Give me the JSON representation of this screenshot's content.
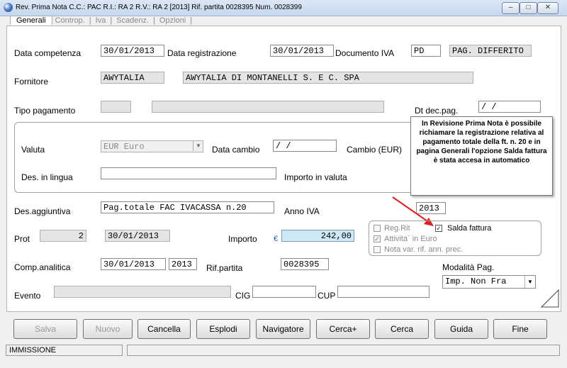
{
  "window": {
    "title": "Rev. Prima Nota C.C.: PAC  R.I.: RA     2 R.V.: RA     2 [2013]    Rif. partita 0028395 Num. 0028399",
    "minimize": "–",
    "maximize": "□",
    "close": "✕"
  },
  "tabs": [
    "Generali",
    "Controp.",
    "Iva",
    "Scadenz.",
    "Opzioni"
  ],
  "tab_separator": "|",
  "form": {
    "data_competenza": {
      "label": "Data competenza",
      "value": "30/01/2013"
    },
    "data_registrazione": {
      "label": "Data registrazione",
      "value": "30/01/2013"
    },
    "documento_iva": {
      "label": "Documento IVA",
      "value": "PD",
      "description": "PAG. DIFFERITO"
    },
    "fornitore": {
      "label": "Fornitore",
      "code": "AWYTALIA",
      "name": "AWYTALIA DI MONTANELLI S. E C. SPA"
    },
    "tipo_pagamento": {
      "label": "Tipo pagamento",
      "code": "",
      "description": ""
    },
    "dt_dec_pag": {
      "label": "Dt dec.pag.",
      "value": " /  /"
    },
    "valuta": {
      "label": "Valuta",
      "value": "EUR Euro",
      "arrow": "▼"
    },
    "data_cambio": {
      "label": "Data cambio",
      "value": " /  /"
    },
    "cambio": {
      "label": "Cambio  (EUR)"
    },
    "des_lingua": {
      "label": "Des. in lingua",
      "value": ""
    },
    "importo_valuta": {
      "label": "Importo in valuta"
    },
    "des_aggiuntiva": {
      "label": "Des.aggiuntiva",
      "value": "Pag.totale FAC IVACASSA n.20"
    },
    "anno_iva": {
      "label": "Anno IVA",
      "value": "2013"
    },
    "prot": {
      "label": "Prot",
      "number": "2",
      "date": "30/01/2013"
    },
    "importo": {
      "label": "Importo",
      "currency": "€",
      "value": "242,00"
    },
    "comp_analitica": {
      "label": "Comp.analitica",
      "date": "30/01/2013",
      "year": "2013"
    },
    "rif_partita": {
      "label": "Rif.partita",
      "value": "0028395"
    },
    "modalita_pag": {
      "label": "Modalità Pag.",
      "value": "Imp. Non Fra",
      "arrow": "▼"
    },
    "evento": {
      "label": "Evento",
      "value": ""
    },
    "cig": {
      "label": "CIG",
      "value": ""
    },
    "cup": {
      "label": "CUP",
      "value": ""
    }
  },
  "checkboxes": [
    {
      "label": "Reg.Rit",
      "checked": false,
      "enabled": false
    },
    {
      "label": "Salda fattura",
      "checked": true,
      "enabled": true
    },
    {
      "label": "Attivita` in Euro",
      "checked": true,
      "enabled": false
    },
    {
      "label": "Nota var. rif. ann. prec.",
      "checked": false,
      "enabled": false
    }
  ],
  "tooltip": "In Revisione Prima Nota è possibile richiamare la registrazione relativa al pagamento totale della ft. n. 20 e in pagina Generali l'opzione Salda fattura è stata accesa in automatico",
  "buttons": [
    {
      "label": "Salva",
      "enabled": false
    },
    {
      "label": "Nuovo",
      "enabled": false
    },
    {
      "label": "Cancella",
      "enabled": true
    },
    {
      "label": "Esplodi",
      "enabled": true
    },
    {
      "label": "Navigatore",
      "enabled": true
    },
    {
      "label": "Cerca+",
      "enabled": true
    },
    {
      "label": "Cerca",
      "enabled": true
    },
    {
      "label": "Guida",
      "enabled": true
    },
    {
      "label": "Fine",
      "enabled": true
    }
  ],
  "status": {
    "mode": "IMMISSIONE",
    "message": ""
  },
  "colors": {
    "highlight_field": "#cfe8f5",
    "arrow": "#e02020"
  }
}
